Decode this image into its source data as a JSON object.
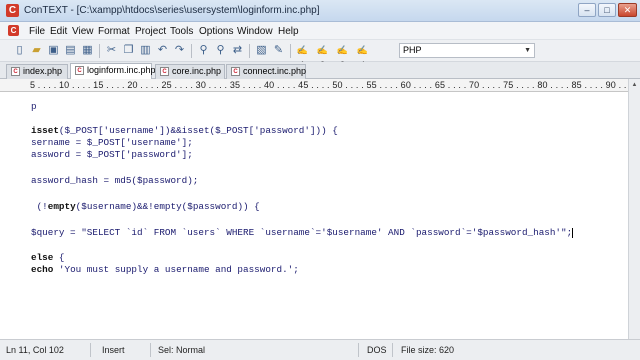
{
  "window": {
    "app_logo": "C",
    "title": "ConTEXT - [C:\\xampp\\htdocs\\series\\usersystem\\loginform.inc.php]",
    "controls": [
      "–",
      "□",
      "✕"
    ]
  },
  "menu": {
    "logo": "C",
    "items": [
      "File",
      "Edit",
      "View",
      "Format",
      "Project",
      "Tools",
      "Options",
      "Window",
      "Help"
    ]
  },
  "toolbar": {
    "buttons": [
      "new-file-icon",
      "open-folder-icon",
      "save-icon",
      "save-all-icon",
      "print-icon",
      "cut-icon",
      "copy-icon",
      "paste-icon",
      "undo-icon",
      "redo-icon",
      "find-icon",
      "find-next-icon",
      "replace-icon",
      "clipboard-icon",
      "tool-icon",
      "highlighter-1-icon",
      "highlighter-2-icon",
      "highlighter-3-icon",
      "highlighter-4-icon"
    ],
    "language": "PHP"
  },
  "tabs": [
    {
      "label": "index.php",
      "active": false
    },
    {
      "label": "loginform.inc.php",
      "active": true
    },
    {
      "label": "core.inc.php",
      "active": false
    },
    {
      "label": "connect.inc.php",
      "active": false
    }
  ],
  "ruler": {
    "text": "5 . . . . 10 . . . . 15 . . . . 20 . . . . 25 . . . . 30 . . . . 35 . . . . 40 . . . . 45 . . . . 50 . . . . 55 . . . . 60 . . . . 65 . . . . 70 . . . . 75 . . . . 80 . . . . 85 . . . . 90 . . . . 95 . . . . 100"
  },
  "editor": {
    "lines": [
      {
        "pre": "",
        "kw": "",
        "text": "p"
      },
      {
        "pre": "",
        "kw": "",
        "text": ""
      },
      {
        "pre": "",
        "kw": "isset",
        "text": "($_POST['username'])&&isset($_POST['password'])) {"
      },
      {
        "pre": "",
        "kw": "",
        "text": "sername = $_POST['username'];"
      },
      {
        "pre": "",
        "kw": "",
        "text": "assword = $_POST['password'];"
      },
      {
        "pre": "",
        "kw": "",
        "text": ""
      },
      {
        "pre": "",
        "kw": "",
        "text": "assword_hash = md5($password);"
      },
      {
        "pre": "",
        "kw": "",
        "text": ""
      },
      {
        "pre": " (!",
        "kw": "empty",
        "text": "($username)&&!empty($password)) {"
      },
      {
        "pre": "",
        "kw": "",
        "text": ""
      },
      {
        "pre": "",
        "kw": "",
        "text": "$query = \"SELECT `id` FROM `users` WHERE `username`='$username' AND `password`='$password_hash'\";"
      },
      {
        "pre": "",
        "kw": "",
        "text": ""
      },
      {
        "pre": "",
        "kw": "else",
        "text": " {"
      },
      {
        "pre": "",
        "kw": "echo",
        "text": " 'You must supply a username and password.';"
      }
    ]
  },
  "status": {
    "position": "Ln 11, Col 102",
    "mode": "Insert",
    "selection": "Sel: Normal",
    "format": "DOS",
    "file_size": "File size: 620"
  }
}
